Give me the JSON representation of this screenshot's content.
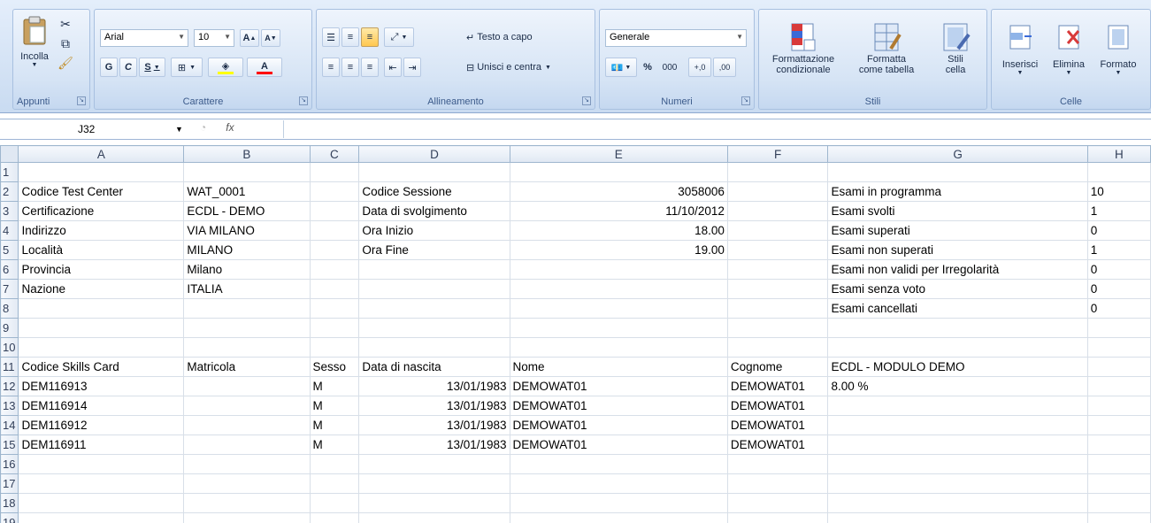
{
  "ribbon": {
    "appunti": {
      "title": "Appunti",
      "incolla": "Incolla",
      "cut_icon": "scissors-icon",
      "copy_icon": "copy-icon",
      "format_painter_icon": "paintbrush-icon"
    },
    "carattere": {
      "title": "Carattere",
      "font": "Arial",
      "size": "10",
      "bold": "G",
      "italic": "C",
      "underline": "S",
      "grow": "A",
      "shrink": "A",
      "fill_color": "#ffff00",
      "font_color": "#ff0000"
    },
    "allineamento": {
      "title": "Allineamento",
      "wrap": "Testo a capo",
      "merge": "Unisci e centra"
    },
    "numeri": {
      "title": "Numeri",
      "format": "Generale",
      "percent": "%",
      "thousands": "000",
      "inc_dec": "+,0",
      "dec_dec": ",00"
    },
    "stili": {
      "title": "Stili",
      "cond_1": "Formattazione",
      "cond_2": "condizionale",
      "table_1": "Formatta",
      "table_2": "come tabella",
      "cell_1": "Stili",
      "cell_2": "cella"
    },
    "celle": {
      "title": "Celle",
      "insert": "Inserisci",
      "delete": "Elimina",
      "format": "Formato"
    }
  },
  "formula_bar": {
    "name_box": "J32",
    "fx": "fx",
    "content": ""
  },
  "columns": [
    "A",
    "B",
    "C",
    "D",
    "E",
    "F",
    "G",
    "H"
  ],
  "rows": [
    {
      "n": "1",
      "c": [
        "",
        "",
        "",
        "",
        "",
        "",
        "",
        ""
      ]
    },
    {
      "n": "2",
      "c": [
        "Codice Test Center",
        "WAT_0001",
        "",
        "Codice Sessione",
        "3058006",
        "",
        "Esami in programma",
        "10"
      ]
    },
    {
      "n": "3",
      "c": [
        "Certificazione",
        "ECDL - DEMO",
        "",
        "Data di svolgimento",
        "11/10/2012",
        "",
        "Esami svolti",
        "1"
      ]
    },
    {
      "n": "4",
      "c": [
        "Indirizzo",
        "VIA MILANO",
        "",
        "Ora Inizio",
        "18.00",
        "",
        "Esami superati",
        "0"
      ]
    },
    {
      "n": "5",
      "c": [
        "Località",
        "MILANO",
        "",
        "Ora Fine",
        "19.00",
        "",
        "Esami non superati",
        "1"
      ]
    },
    {
      "n": "6",
      "c": [
        "Provincia",
        "Milano",
        "",
        "",
        "",
        "",
        "Esami non validi per Irregolarità",
        "0"
      ]
    },
    {
      "n": "7",
      "c": [
        "Nazione",
        "ITALIA",
        "",
        "",
        "",
        "",
        "Esami senza voto",
        "0"
      ]
    },
    {
      "n": "8",
      "c": [
        "",
        "",
        "",
        "",
        "",
        "",
        "Esami cancellati",
        "0"
      ]
    },
    {
      "n": "9",
      "c": [
        "",
        "",
        "",
        "",
        "",
        "",
        "",
        ""
      ]
    },
    {
      "n": "10",
      "c": [
        "",
        "",
        "",
        "",
        "",
        "",
        "",
        ""
      ]
    },
    {
      "n": "11",
      "c": [
        "Codice Skills Card",
        "Matricola",
        "Sesso",
        "Data di nascita",
        "Nome",
        "Cognome",
        "ECDL - MODULO DEMO",
        ""
      ]
    },
    {
      "n": "12",
      "c": [
        "DEM116913",
        "",
        "M",
        "13/01/1983",
        "DEMOWAT01",
        "DEMOWAT01",
        "8.00 %",
        ""
      ]
    },
    {
      "n": "13",
      "c": [
        "DEM116914",
        "",
        "M",
        "13/01/1983",
        "DEMOWAT01",
        "DEMOWAT01",
        "",
        ""
      ]
    },
    {
      "n": "14",
      "c": [
        "DEM116912",
        "",
        "M",
        "13/01/1983",
        "DEMOWAT01",
        "DEMOWAT01",
        "",
        ""
      ]
    },
    {
      "n": "15",
      "c": [
        "DEM116911",
        "",
        "M",
        "13/01/1983",
        "DEMOWAT01",
        "DEMOWAT01",
        "",
        ""
      ]
    },
    {
      "n": "16",
      "c": [
        "",
        "",
        "",
        "",
        "",
        "",
        "",
        ""
      ]
    },
    {
      "n": "17",
      "c": [
        "",
        "",
        "",
        "",
        "",
        "",
        "",
        ""
      ]
    },
    {
      "n": "18",
      "c": [
        "",
        "",
        "",
        "",
        "",
        "",
        "",
        ""
      ]
    },
    {
      "n": "19",
      "c": [
        "",
        "",
        "",
        "",
        "",
        "",
        "",
        ""
      ]
    }
  ]
}
